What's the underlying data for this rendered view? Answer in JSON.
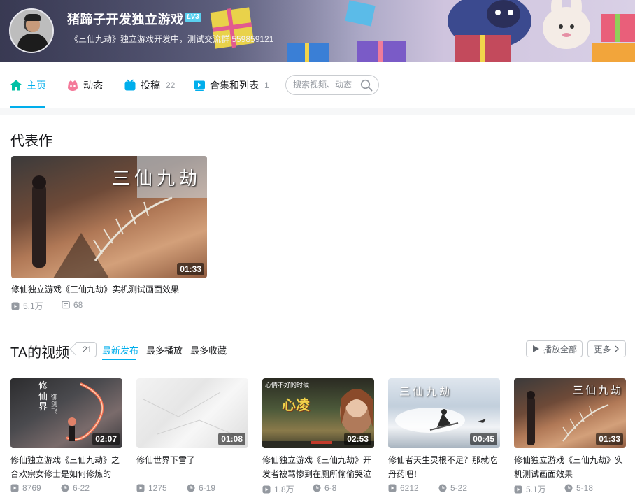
{
  "profile": {
    "name": "猪蹄子开发独立游戏",
    "level": "LV3",
    "signature": "《三仙九劫》独立游戏开发中，测试交流群 559859121"
  },
  "nav": {
    "items": [
      {
        "label": "主页",
        "count": ""
      },
      {
        "label": "动态",
        "count": ""
      },
      {
        "label": "投稿",
        "count": "22"
      },
      {
        "label": "合集和列表",
        "count": "1"
      }
    ],
    "search_placeholder": "搜索视频、动态"
  },
  "masterpiece": {
    "title": "代表作",
    "video": {
      "thumb_text": "三仙九劫",
      "duration": "01:33",
      "title": "修仙独立游戏《三仙九劫》实机测试画面效果",
      "views": "5.1万",
      "danmaku": "68"
    }
  },
  "videos": {
    "title": "TA的视频",
    "count": "21",
    "tabs": [
      "最新发布",
      "最多播放",
      "最多收藏"
    ],
    "play_all": "播放全部",
    "more": "更多",
    "list": [
      {
        "thumb_text": "修仙界",
        "thumb_sub": "御剑飞",
        "duration": "02:07",
        "title": "修仙独立游戏《三仙九劫》之合欢宗女修士是如何修炼的",
        "views": "8769",
        "date": "6-22"
      },
      {
        "thumb_text": "",
        "thumb_sub": "",
        "duration": "01:08",
        "title": "修仙世界下雪了",
        "views": "1275",
        "date": "6-19"
      },
      {
        "thumb_text": "心凌",
        "thumb_sub": "心情不好的时候",
        "duration": "02:53",
        "title": "修仙独立游戏《三仙九劫》开发者被骂惨到在厕所偷偷哭泣",
        "views": "1.8万",
        "date": "6-8"
      },
      {
        "thumb_text": "三仙九劫",
        "thumb_sub": "",
        "duration": "00:45",
        "title": "修仙者天生灵根不足？那就吃丹药吧！",
        "views": "6212",
        "date": "5-22"
      },
      {
        "thumb_text": "三仙九劫",
        "thumb_sub": "",
        "duration": "01:33",
        "title": "修仙独立游戏《三仙九劫》实机测试画面效果",
        "views": "5.1万",
        "date": "5-18"
      }
    ]
  },
  "colors": {
    "accent": "#00aeec",
    "text": "#18191c",
    "muted": "#9499a0"
  }
}
